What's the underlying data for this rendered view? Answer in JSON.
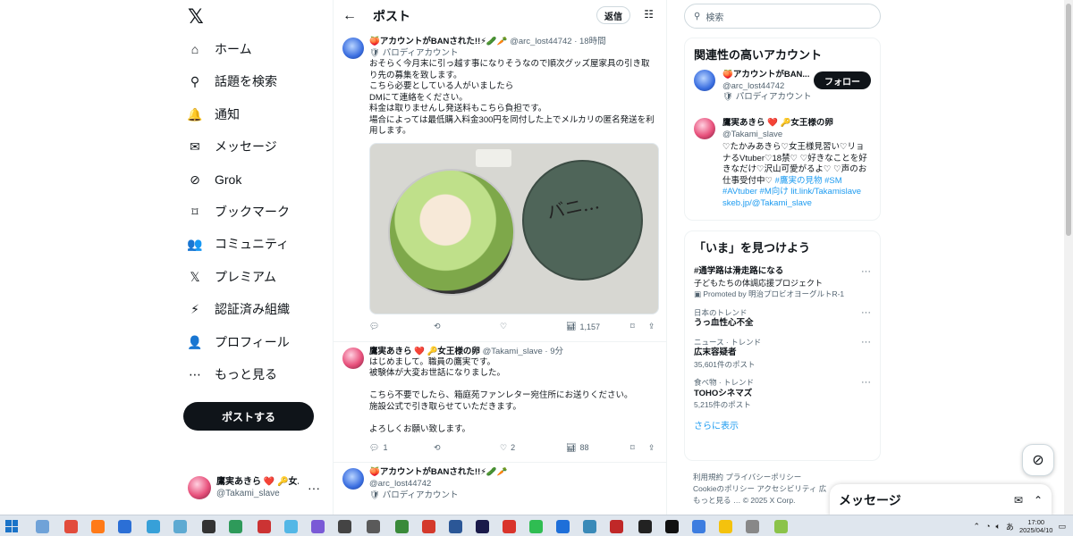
{
  "nav": {
    "items": [
      {
        "label": "ホーム",
        "icon": "home-icon",
        "glyph": "⌂"
      },
      {
        "label": "話題を検索",
        "icon": "search-icon",
        "glyph": "⚲"
      },
      {
        "label": "通知",
        "icon": "bell-icon",
        "glyph": "🔔"
      },
      {
        "label": "メッセージ",
        "icon": "envelope-icon",
        "glyph": "✉"
      },
      {
        "label": "Grok",
        "icon": "grok-icon",
        "glyph": "⊘"
      },
      {
        "label": "ブックマーク",
        "icon": "bookmark-icon",
        "glyph": "⌑"
      },
      {
        "label": "コミュニティ",
        "icon": "community-icon",
        "glyph": "👥"
      },
      {
        "label": "プレミアム",
        "icon": "x-premium-icon",
        "glyph": "𝕏"
      },
      {
        "label": "認証済み組織",
        "icon": "lightning-icon",
        "glyph": "⚡"
      },
      {
        "label": "プロフィール",
        "icon": "profile-icon",
        "glyph": "👤"
      },
      {
        "label": "もっと見る",
        "icon": "more-circle-icon",
        "glyph": "⋯"
      }
    ],
    "post_button": "ポストする",
    "me_name": "鷹実あきら ❤️ 🔑女...",
    "me_handle": "@Takami_slave",
    "more_glyph": "···"
  },
  "main": {
    "title": "ポスト",
    "reply_label": "返信",
    "posts": [
      {
        "name": "🍑アカウントがBANされた!!⚡🥒🥕",
        "handle": "@arc_lost44742",
        "time": "18時間",
        "parody": "🛡 パロディアカウント",
        "text": "おそらく今月末に引っ越す事になりそうなので順次グッズ屋家具の引き取り先の募集を致します。\nこちら必要としている人がいましたら\nDMにて連絡をください。\n料金は取りませんし発送料もこちら負担です。\n場合によっては最低購入料金300円を同付した上でメルカリの匿名発送を利用します。",
        "views": "1,157",
        "media_scrawl": "バニ..."
      },
      {
        "name": "鷹実あきら ❤️ 🔑女王様の卵",
        "handle": "@Takami_slave",
        "time": "9分",
        "text": "はじめまして。職員の鷹実です。\n被験体が大変お世話になりました。\n\nこちら不要でしたら、箱庭苑ファンレター宛住所にお送りください。\n施設公式で引き取らせていただきます。\n\nよろしくお願い致します。",
        "replies": "1",
        "likes": "2",
        "views": "88"
      },
      {
        "name": "🍑アカウントがBANされた!!⚡🥒🥕",
        "handle": "@arc_lost44742",
        "parody": "🛡 パロディアカウント"
      }
    ]
  },
  "right": {
    "search_placeholder": "検索",
    "related_title": "関連性の高いアカウント",
    "acc1": {
      "name": "🍑アカウントがBAN...",
      "handle": "@arc_lost44742",
      "parody": "🛡 パロディアカウント",
      "follow": "フォロー"
    },
    "acc2": {
      "name": "鷹実あきら ❤️ 🔑女王様の卵",
      "handle": "@Takami_slave",
      "bio": "♡たかみあきら♡女王様見習い♡リョナるVtuber♡18禁♡ ♡好きなことを好きなだけ♡沢山可愛がるよ♡ ♡声のお仕事受付中♡ ",
      "bio_tags": "#鷹実の見物 #SM #AVtuber #M向け lit.link/Takamislave skeb.jp/@Takami_slave"
    },
    "trends_title": "「いま」を見つけよう",
    "trends": [
      {
        "ctx": "",
        "name": "#通学路は滑走路になる",
        "sub": "子どもたちの体調応援プロジェクト",
        "count": "▣ Promoted by 明治プロビオヨーグルトR-1"
      },
      {
        "ctx": "日本のトレンド",
        "name": "うっ血性心不全",
        "sub": "",
        "count": ""
      },
      {
        "ctx": "ニュース · トレンド",
        "name": "広末容疑者",
        "sub": "",
        "count": "35,601件のポスト"
      },
      {
        "ctx": "食べ物 · トレンド",
        "name": "TOHOシネマズ",
        "sub": "",
        "count": "5,215件のポスト"
      }
    ],
    "show_more": "さらに表示",
    "footer1": "利用規約  プライバシーポリシー",
    "footer2": "Cookieのポリシー  アクセシビリティ  広",
    "footer3": "もっと見る …  © 2025 X Corp."
  },
  "drawer": {
    "title": "メッセージ"
  },
  "taskbar": {
    "time": "17:00",
    "date": "2025/04/10",
    "ime": "あ"
  },
  "colors": {
    "accent": "#1d9bf0",
    "dark": "#0f1419",
    "muted": "#536471"
  }
}
